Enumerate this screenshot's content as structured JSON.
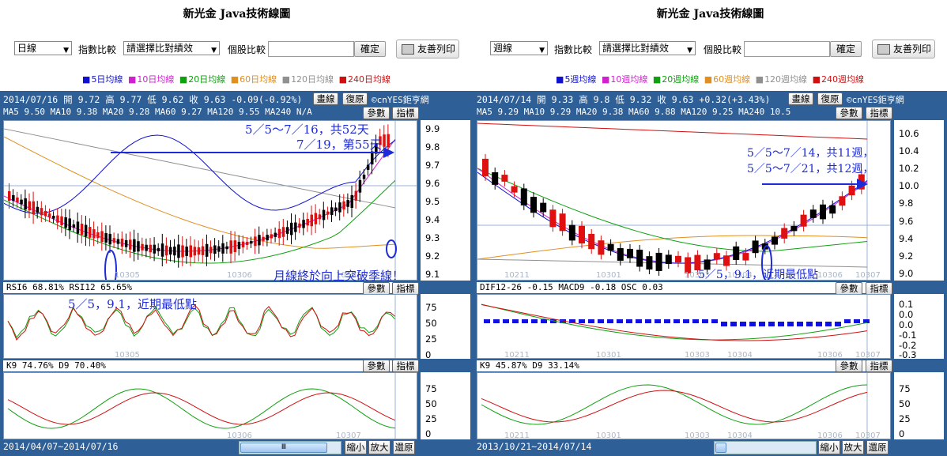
{
  "left": {
    "title": "新光金 Java技術線圖",
    "period_select": "日線",
    "index_label": "指數比較",
    "index_select": "請選擇比對績效",
    "stock_label": "個股比較",
    "confirm": "確定",
    "print": "友善列印",
    "legend": [
      {
        "text": "5日均線",
        "color": "#1010d0"
      },
      {
        "text": "10日均線",
        "color": "#d020d0"
      },
      {
        "text": "20日均線",
        "color": "#10a010"
      },
      {
        "text": "60日均線",
        "color": "#e09020"
      },
      {
        "text": "120日均線",
        "color": "#909090"
      },
      {
        "text": "240日均線",
        "color": "#d01010"
      }
    ],
    "info": "2014/07/16 開 9.72 高 9.77 低 9.62 收 9.63 -0.09(-0.92%)",
    "btn_draw": "畫線",
    "btn_restore": "復原",
    "brand": "©cnYES鉅亨網",
    "ma_line": "MA5 9.50   MA10 9.38   MA20 9.28   MA60 9.27   MA120 9.55   MA240 N/A",
    "btn_param": "參數",
    "btn_indicator": "指標",
    "price_axis": [
      "9.9",
      "9.8",
      "9.7",
      "9.6",
      "9.5",
      "9.4",
      "9.3",
      "9.2",
      "9.1"
    ],
    "date_ticks": [
      "10305",
      "10306",
      "10307"
    ],
    "anno1": "5／5～7／16，共52天",
    "anno2": "7／19，第55天",
    "anno3": "月線終於向上突破季線！",
    "rsi_line": "RSI6 68.81%  RSI12 65.65%",
    "rsi_anno": "5／5，9.1，近期最低點",
    "rsi_axis": [
      "75",
      "50",
      "25",
      "0"
    ],
    "kd_line": "K9 74.76%  D9 70.40%",
    "kd_axis": [
      "75",
      "50",
      "25",
      "0"
    ],
    "range": "2014/04/07~2014/07/16",
    "zoom_out": "縮小",
    "zoom_in": "放大",
    "reset": "還原",
    "thumb": "Ⅲ"
  },
  "right": {
    "title": "新光金 Java技術線圖",
    "period_select": "週線",
    "index_label": "指數比較",
    "index_select": "請選擇比對績效",
    "stock_label": "個股比較",
    "confirm": "確定",
    "print": "友善列印",
    "legend": [
      {
        "text": "5週均線",
        "color": "#1010d0"
      },
      {
        "text": "10週均線",
        "color": "#d020d0"
      },
      {
        "text": "20週均線",
        "color": "#10a010"
      },
      {
        "text": "60週均線",
        "color": "#e09020"
      },
      {
        "text": "120週均線",
        "color": "#909090"
      },
      {
        "text": "240週均線",
        "color": "#d01010"
      }
    ],
    "info": "2014/07/14 開 9.33 高 9.8 低 9.32 收 9.63 +0.32(+3.43%)",
    "btn_draw": "畫線",
    "btn_restore": "復原",
    "brand": "©cnYES鉅亨網",
    "ma_line": "MA5 9.29   MA10 9.29   MA20 9.38   MA60 9.88   MA120 9.25   MA240 10.5",
    "btn_param": "參數",
    "btn_indicator": "指標",
    "price_axis": [
      "10.6",
      "10.4",
      "10.2",
      "10.0",
      "9.8",
      "9.6",
      "9.4",
      "9.2",
      "9.0"
    ],
    "date_ticks": [
      "10211",
      "10301",
      "10303",
      "10304",
      "10306",
      "10307"
    ],
    "anno1": "5／5～7／14，共11週，",
    "anno2": "5／5～7／21，共12週，",
    "anno3": "5／5，9.1，近期最低點",
    "macd_line": "DIF12-26 -0.15  MACD9 -0.18  OSC 0.03",
    "macd_axis": [
      "0.1",
      "0.0",
      "0.0",
      "-0.1",
      "-0.2",
      "-0.3"
    ],
    "kd_line": "K9 45.87%  D9 33.14%",
    "kd_axis": [
      "75",
      "50",
      "25",
      "0"
    ],
    "range": "2013/10/21~2014/07/14",
    "zoom_out": "縮小",
    "zoom_in": "放大",
    "reset": "還原"
  }
}
